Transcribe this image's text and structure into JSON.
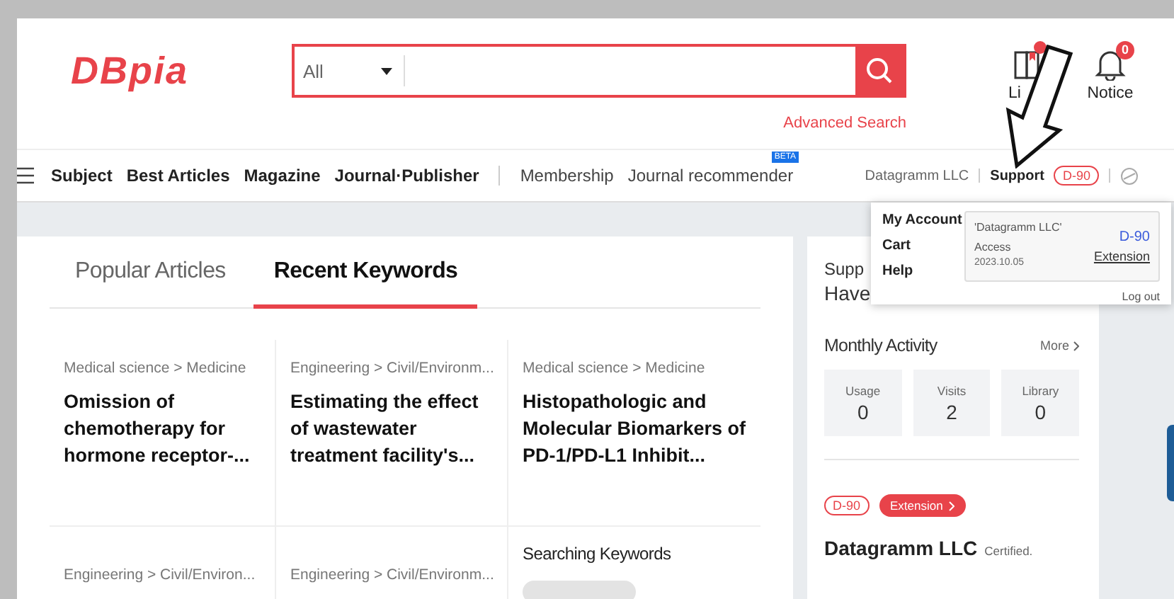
{
  "logo": {
    "text": "DBpia"
  },
  "search": {
    "scope": "All",
    "advanced": "Advanced Search"
  },
  "header_icons": [
    {
      "kind": "library",
      "label": "Li",
      "has_badge": true
    },
    {
      "kind": "notice",
      "label": "Notice",
      "has_badge": true,
      "badge": "0"
    }
  ],
  "nav": {
    "primary": [
      {
        "label": "Subject"
      },
      {
        "label": "Best Articles"
      },
      {
        "label": "Magazine"
      },
      {
        "label": "Journal·Publisher"
      }
    ],
    "secondary": [
      {
        "label": "Membership",
        "beta": false
      },
      {
        "label": "Journal recommender",
        "beta": true,
        "beta_text": "BETA"
      }
    ]
  },
  "user_nav": {
    "org": "Datagramm LLC",
    "support": "Support",
    "dday": "D-90"
  },
  "dropdown": {
    "links": [
      "My Account",
      "Cart",
      "Help"
    ],
    "access": "'Datagramm LLC' Access",
    "date": "2023.10.05",
    "dday": "D-90",
    "extension": "Extension",
    "logout": "Log out"
  },
  "tabs": [
    {
      "label": "Popular Articles",
      "selected": false
    },
    {
      "label": "Recent Keywords",
      "selected": true
    }
  ],
  "articles": [
    {
      "category": "Medical science > Medicine",
      "title": "Omission of chemotherapy for hormone receptor-..."
    },
    {
      "category": "Engineering > Civil/Environm...",
      "title": "Estimating the effect of wastewater treatment facility's..."
    },
    {
      "category": "Medical science > Medicine",
      "title": "Histopathologic and Molecular Biomarkers of PD-1/PD-L1 Inhibit..."
    },
    {
      "category": "Engineering > Civil/Environ..."
    },
    {
      "category": "Engineering > Civil/Environm..."
    }
  ],
  "searching_keywords": {
    "title": "Searching Keywords"
  },
  "side": {
    "line1": "Supp",
    "line2": "Have",
    "monthly_title": "Monthly Activity",
    "more": "More",
    "stats": [
      {
        "label": "Usage",
        "value": "0"
      },
      {
        "label": "Visits",
        "value": "2"
      },
      {
        "label": "Library",
        "value": "0"
      }
    ],
    "dday": "D-90",
    "extension": "Extension",
    "org": "Datagramm LLC",
    "certified": "Certified."
  }
}
